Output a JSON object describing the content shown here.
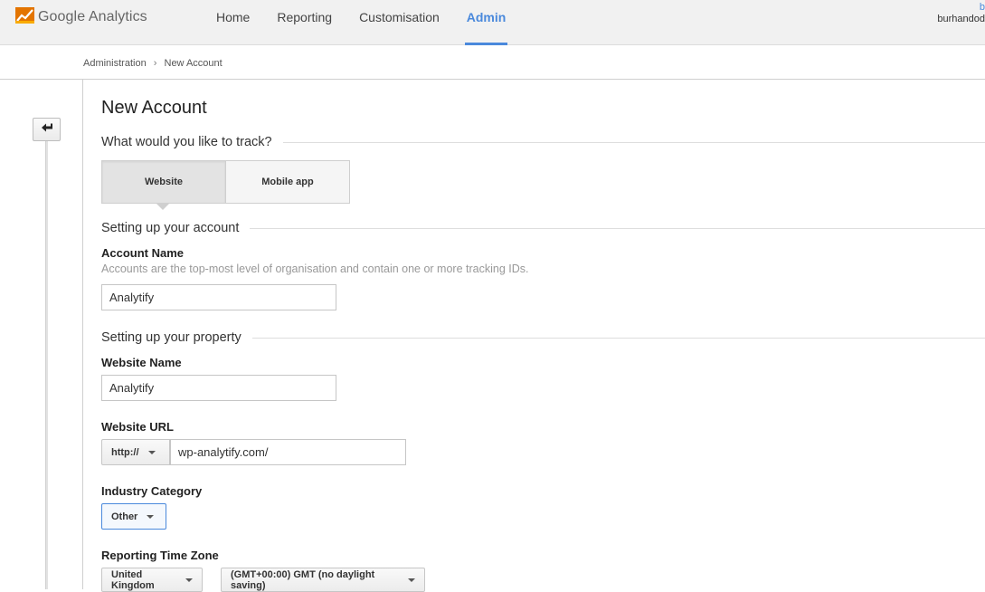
{
  "header": {
    "logo_brand": "Google Analytics",
    "nav": [
      {
        "label": "Home"
      },
      {
        "label": "Reporting"
      },
      {
        "label": "Customisation"
      },
      {
        "label": "Admin"
      }
    ],
    "active_nav": "Admin",
    "user_top": "b",
    "user_name": "burhandod"
  },
  "breadcrumb": {
    "first": "Administration",
    "separator": "›",
    "second": "New Account"
  },
  "page": {
    "title": "New Account",
    "track_question": "What would you like to track?",
    "track_options": [
      "Website",
      "Mobile app"
    ],
    "track_selected": "Website",
    "account_section": "Setting up your account",
    "account_name_label": "Account Name",
    "account_name_help": "Accounts are the top-most level of organisation and contain one or more tracking IDs.",
    "account_name_value": "Analytify",
    "property_section": "Setting up your property",
    "website_name_label": "Website Name",
    "website_name_value": "Analytify",
    "website_url_label": "Website URL",
    "protocol_value": "http://",
    "website_url_value": "wp-analytify.com/",
    "industry_label": "Industry Category",
    "industry_value": "Other",
    "timezone_label": "Reporting Time Zone",
    "timezone_country": "United Kingdom",
    "timezone_value": "(GMT+00:00) GMT (no daylight saving)"
  },
  "colors": {
    "accent": "#4a89dc",
    "logo_orange": "#e37400"
  }
}
